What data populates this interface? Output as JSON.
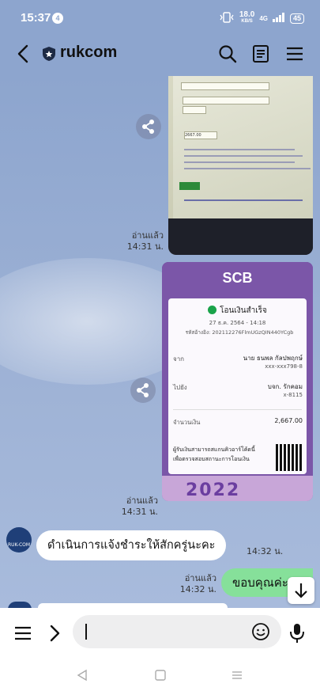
{
  "status_bar": {
    "time": "15:37",
    "notification_count": "4",
    "net_speed_value": "18.0",
    "net_speed_unit": "KB/S",
    "network_type": "4G",
    "battery": "45"
  },
  "header": {
    "title": "rukcom"
  },
  "messages": {
    "image1": {
      "read_label": "อ่านแล้ว",
      "time": "14:31 น."
    },
    "image2": {
      "read_label": "อ่านแล้ว",
      "time": "14:31 น."
    },
    "incoming": {
      "text": "ดำเนินการแจ้งชำระให้สักครู่นะคะ",
      "time": "14:32 น."
    },
    "outgoing": {
      "text": "ขอบคุณค่ะ",
      "read_label": "อ่านแล้ว",
      "time": "14:32 น."
    }
  },
  "slip": {
    "bank": "SCB",
    "status": "โอนเงินสำเร็จ",
    "date": "27 ธ.ค. 2564 - 14:18",
    "ref": "รหัสอ้างอิง: 20211227​6FlmUGzQIN440YCgb",
    "from_label": "จาก",
    "from_name": "นาย ธนพล กัลปพฤกษ์",
    "from_acct": "xxx-xxx798-8",
    "to_label": "ไปยัง",
    "to_name": "บจก. รักคอม",
    "to_acct": "x-8115",
    "amount_label": "จำนวนเงิน",
    "amount": "2,667.00",
    "qr_text_1": "ผู้รับเงินสามารถสแกนคิวอาร์โค้ดนี้",
    "qr_text_2": "เพื่อตรวจสอบสถานะการโอนเงิน",
    "year": "2022"
  },
  "photo": {
    "field_value": "2667.00"
  },
  "avatar_label": "RUK-COM",
  "colors": {
    "chat_bg": "#8da5ce",
    "outgoing_bubble": "#86e09a",
    "slip_purple": "#7b56a8"
  }
}
